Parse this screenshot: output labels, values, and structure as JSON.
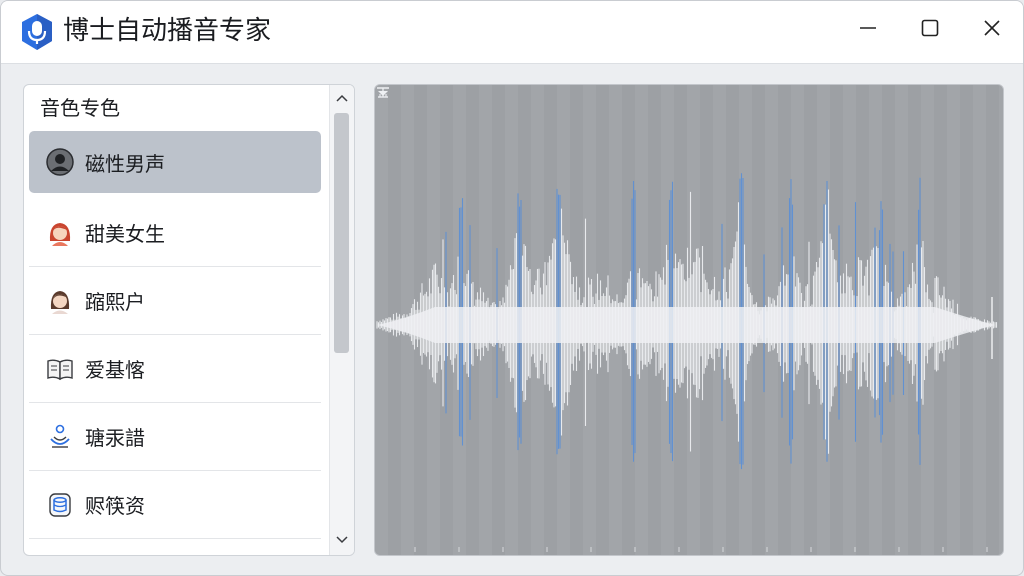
{
  "app": {
    "title": "博士自动播音专家",
    "accent": "#2d6fe0",
    "icon": "microphone-shield-icon"
  },
  "window_controls": [
    {
      "name": "minimize",
      "icon": "minimize-icon"
    },
    {
      "name": "maximize",
      "icon": "maximize-icon"
    },
    {
      "name": "close",
      "icon": "close-icon"
    }
  ],
  "sidebar": {
    "header": "音色专色",
    "items": [
      {
        "label": "磁性男声",
        "icon": "male-avatar-icon",
        "selected": true
      },
      {
        "label": "甜美女生",
        "icon": "female-avatar-icon",
        "selected": false
      },
      {
        "label": "蹜熙户",
        "icon": "girl-avatar-icon",
        "selected": false
      },
      {
        "label": "爱基愘",
        "icon": "book-icon",
        "selected": false
      },
      {
        "label": "瑭汞諎",
        "icon": "meditation-icon",
        "selected": false
      },
      {
        "label": "赆筷资",
        "icon": "database-icon",
        "selected": false
      }
    ]
  },
  "waveform": {
    "background": "#9da0a4",
    "wave_color": "#eef0f3",
    "peak_color": "#5b8fd6",
    "top_icon": "anchor-icon",
    "bottom_icon": "filter-icon"
  }
}
